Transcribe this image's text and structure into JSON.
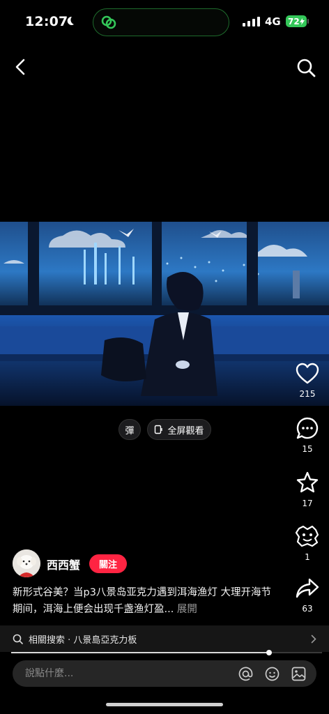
{
  "status_bar": {
    "time": "12:07",
    "network": "4G",
    "battery": "72",
    "island_color": "#34c759"
  },
  "nav": {
    "back_icon": "chevron-left-icon",
    "search_icon": "search-icon"
  },
  "video": {
    "danmu_label": "彈",
    "fullscreen_label": "全屏觀看",
    "progress": 0.83
  },
  "actions": {
    "likes": "215",
    "comments": "15",
    "collects": "17",
    "shares_emoji": "1",
    "forwards": "63"
  },
  "author": {
    "name": "西西蟹",
    "follow_label": "關注",
    "follow_color": "#ff2442"
  },
  "caption": {
    "text": "新形式谷美？当p3八景岛亚克力遇到洱海渔灯 大理开海节期间，洱海上便会出现千盏渔灯盈...",
    "more": " 展開"
  },
  "related": {
    "label": "相關搜索 · 八景島亞克力板"
  },
  "comment": {
    "placeholder": "說點什麼..."
  }
}
